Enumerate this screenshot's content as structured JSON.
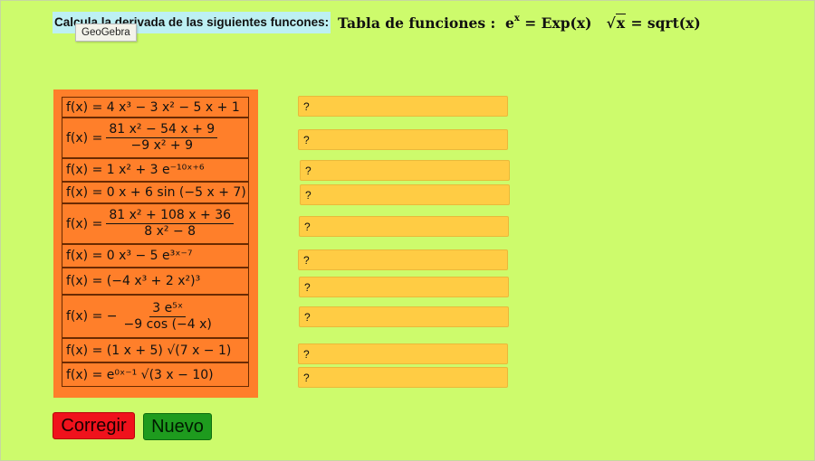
{
  "header": {
    "instruction": "Calcula la derivada de las siguientes funcones:",
    "tooltip": "GeoGebra",
    "table_label": "Tabla de funciones :",
    "exp_lhs_base": "e",
    "exp_lhs_sup": "x",
    "exp_rhs": "= Exp(x)",
    "sqrt_arg": "x",
    "sqrt_rhs": "= sqrt(x)"
  },
  "functions": [
    {
      "text": "f(x) = 4 x³ − 3 x² − 5 x + 1"
    },
    {
      "fx": "f(x) =",
      "num": "81 x² − 54 x + 9",
      "den": "−9 x² + 9"
    },
    {
      "text": "f(x) = 1 x² + 3 e⁻¹⁰ˣ⁺⁶"
    },
    {
      "text": "f(x) = 0 x + 6  sin (−5 x + 7)"
    },
    {
      "fx": "f(x) =",
      "num": "81 x² + 108 x + 36",
      "den": "8 x² − 8"
    },
    {
      "text": "f(x) = 0 x³ − 5 e³ˣ⁻⁷"
    },
    {
      "text": "f(x) = (−4 x³ + 2 x²)³"
    },
    {
      "fx": "f(x) = −",
      "num": "3 e⁵ˣ",
      "den": "−9  cos (−4 x)"
    },
    {
      "text": "f(x) = (1 x + 5)  √(7 x − 1)"
    },
    {
      "text": "f(x) = e⁰ˣ⁻¹  √(3 x − 10)"
    }
  ],
  "answers": [
    "?",
    "?",
    "?",
    "?",
    "?",
    "?",
    "?",
    "?",
    "?",
    "?"
  ],
  "buttons": {
    "corregir": "Corregir",
    "nuevo": "Nuevo"
  },
  "colors": {
    "background": "#cdfb6c",
    "panel": "#ff7f2a",
    "answer_field": "#ffcc44",
    "corregir": "#f0121c",
    "nuevo": "#1e9b1e"
  }
}
